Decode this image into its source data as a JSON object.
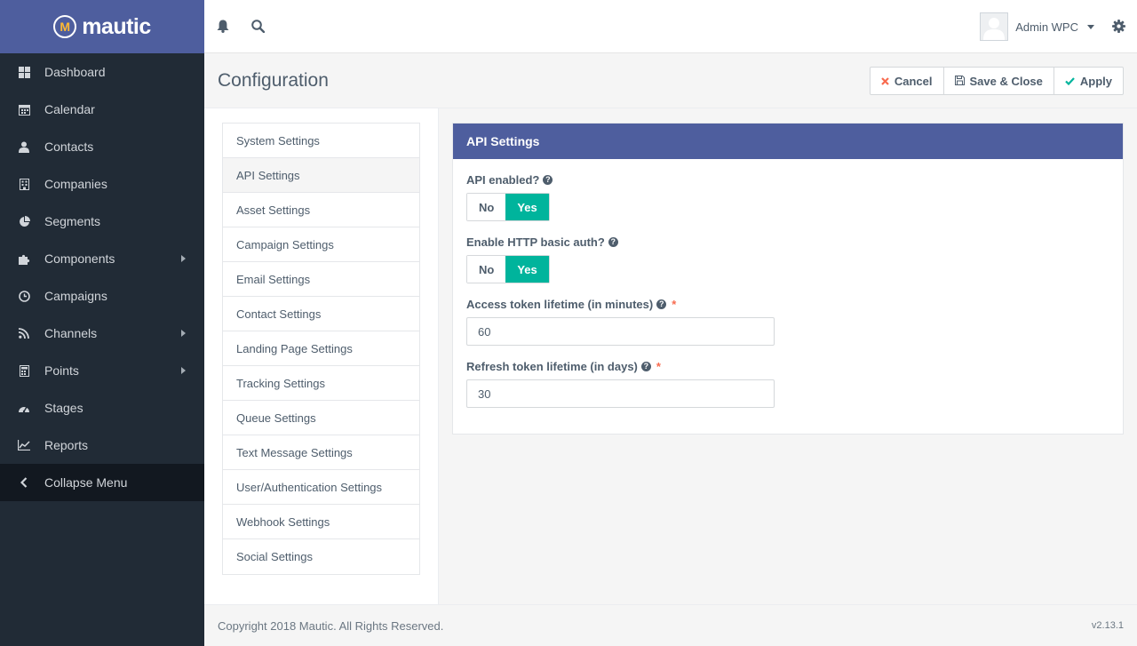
{
  "app": {
    "logo_text": "mautic",
    "logo_mark": "M"
  },
  "sidebar": {
    "items": [
      {
        "label": "Dashboard",
        "icon": "dashboard-icon",
        "has_submenu": false
      },
      {
        "label": "Calendar",
        "icon": "calendar-icon",
        "has_submenu": false
      },
      {
        "label": "Contacts",
        "icon": "user-icon",
        "has_submenu": false
      },
      {
        "label": "Companies",
        "icon": "building-icon",
        "has_submenu": false
      },
      {
        "label": "Segments",
        "icon": "pie-chart-icon",
        "has_submenu": false
      },
      {
        "label": "Components",
        "icon": "puzzle-icon",
        "has_submenu": true
      },
      {
        "label": "Campaigns",
        "icon": "clock-icon",
        "has_submenu": false
      },
      {
        "label": "Channels",
        "icon": "rss-icon",
        "has_submenu": true
      },
      {
        "label": "Points",
        "icon": "calculator-icon",
        "has_submenu": true
      },
      {
        "label": "Stages",
        "icon": "tachometer-icon",
        "has_submenu": false
      },
      {
        "label": "Reports",
        "icon": "line-chart-icon",
        "has_submenu": false
      }
    ],
    "collapse_label": "Collapse Menu"
  },
  "topbar": {
    "notifications_icon": "bell-icon",
    "search_icon": "search-icon",
    "user_name": "Admin WPC",
    "settings_icon": "gear-icon"
  },
  "page": {
    "title": "Configuration",
    "buttons": {
      "cancel": "Cancel",
      "save_close": "Save & Close",
      "apply": "Apply"
    }
  },
  "settings_nav": {
    "items": [
      "System Settings",
      "API Settings",
      "Asset Settings",
      "Campaign Settings",
      "Email Settings",
      "Contact Settings",
      "Landing Page Settings",
      "Tracking Settings",
      "Queue Settings",
      "Text Message Settings",
      "User/Authentication Settings",
      "Webhook Settings",
      "Social Settings"
    ],
    "active": "API Settings"
  },
  "panel": {
    "title": "API Settings",
    "api_enabled": {
      "label": "API enabled?",
      "no": "No",
      "yes": "Yes",
      "selected": "Yes"
    },
    "http_basic_auth": {
      "label": "Enable HTTP basic auth?",
      "no": "No",
      "yes": "Yes",
      "selected": "Yes"
    },
    "access_token": {
      "label": "Access token lifetime (in minutes)",
      "required_mark": "*",
      "value": "60"
    },
    "refresh_token": {
      "label": "Refresh token lifetime (in days)",
      "required_mark": "*",
      "value": "30"
    }
  },
  "footer": {
    "copyright": "Copyright 2018 Mautic. All Rights Reserved.",
    "version": "v2.13.1"
  },
  "colors": {
    "brand": "#4e5e9e",
    "sidebar_bg": "#212b36",
    "toggle_on": "#00b49c",
    "required": "#f86b4f",
    "cancel_icon": "#f86b4f",
    "apply_icon": "#00b49c"
  }
}
